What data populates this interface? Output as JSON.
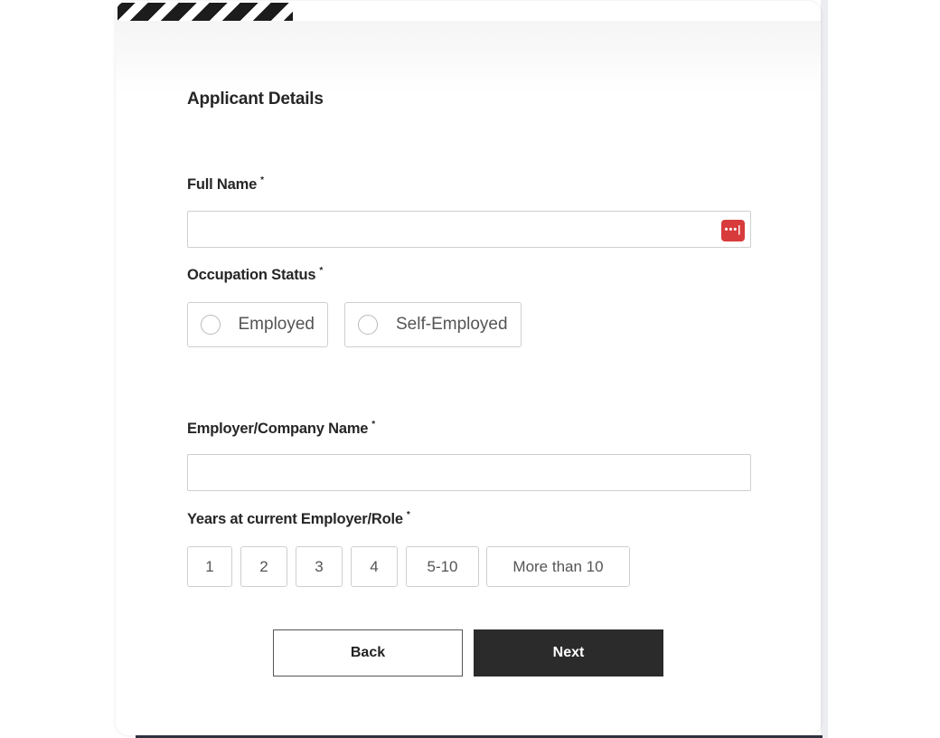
{
  "form": {
    "section_title": "Applicant Details",
    "full_name": {
      "label": "Full Name",
      "required_mark": "*",
      "value": "",
      "badge_text": "•••|",
      "badge_icon": "password-manager-icon",
      "badge_color": "#d83b3b"
    },
    "occupation_status": {
      "label": "Occupation Status",
      "required_mark": "*",
      "options": [
        "Employed",
        "Self-Employed"
      ],
      "selected": null
    },
    "employer_name": {
      "label": "Employer/Company Name",
      "required_mark": "*",
      "value": ""
    },
    "years_at_employer": {
      "label": "Years at current Employer/Role",
      "required_mark": "*",
      "options": [
        "1",
        "2",
        "3",
        "4",
        "5-10",
        "More than 10"
      ],
      "selected": null
    },
    "buttons": {
      "back_label": "Back",
      "next_label": "Next"
    }
  },
  "colors": {
    "primary_button": "#2b2b2b",
    "border": "#cfcfcf",
    "badge": "#d83b3b"
  }
}
